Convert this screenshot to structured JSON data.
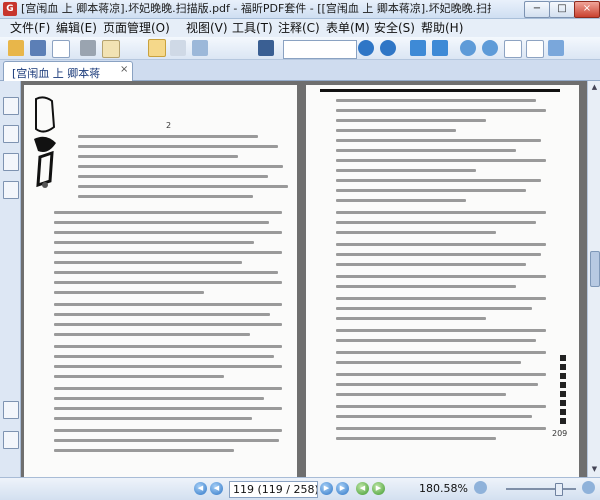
{
  "window": {
    "title": "[宫闱血 上 卿本蒋凉].坏妃晚晚.扫描版.pdf - 福昕PDF套件 - [[宫闱血 上 卿本蒋凉].坏妃晚晚.扫描版.pdf]",
    "controls": [
      "−",
      "□",
      "×"
    ]
  },
  "menu": {
    "items": [
      "文件(F)",
      "编辑(E)",
      "页面管理(O)",
      "视图(V)",
      "工具(T)",
      "注释(C)",
      "表单(M)",
      "安全(S)",
      "帮助(H)"
    ]
  },
  "toolbar": {
    "icons": [
      "open-folder-icon",
      "save-icon",
      "new-document-icon",
      "print-icon",
      "email-icon",
      "hand-tool-icon",
      "select-text-icon",
      "snapshot-icon",
      "find-binoculars-icon",
      "find-previous-icon",
      "find-next-icon",
      "back-icon",
      "forward-icon",
      "zoom-in-icon",
      "zoom-out-icon",
      "fit-page-icon",
      "fit-width-icon",
      "rotate-icon"
    ],
    "find_value": ""
  },
  "tab": {
    "label": "[宫闱血 上 卿本蒋",
    "close": "×"
  },
  "sidebar": {
    "icons": [
      "bookmarks-icon",
      "pages-icon",
      "layers-icon",
      "comments-icon",
      "attachments-icon",
      "signature-icon"
    ]
  },
  "document": {
    "left_page": {
      "vertical_title": "宫闱血",
      "page_number": "2"
    },
    "right_page": {
      "page_number": "209"
    }
  },
  "status": {
    "page_display": "119 (119 / 258)",
    "zoom": "180.58%",
    "zoom_level": 0.75
  },
  "colors": {
    "accent": "#2f76c6",
    "highlight": "#f5d88a"
  }
}
